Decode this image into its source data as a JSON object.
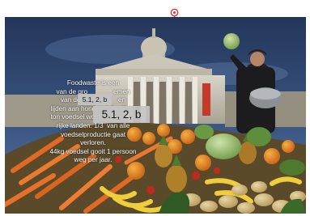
{
  "caption": {
    "lines": [
      "Foodwaste is een",
      "van de gro              emen",
      "van deze tijd           en",
      "lijden aan honger. 1,3 miljard",
      "ton voedsel word  versp      n",
      "rijke landen. 1/3  van alle",
      "voedselproductie gaat verloren.",
      "44kg voedsel gooit 1 persoon",
      "weg per jaar."
    ]
  },
  "overlays": {
    "small_label": "5.1, 2, b",
    "large_label": "5.1, 2, b"
  },
  "colors": {
    "sky": "#2c3f63",
    "marker": "#d23a3a",
    "label_bg": "#c3c3c3"
  },
  "icons": {
    "marker": "location-pin-icon"
  }
}
